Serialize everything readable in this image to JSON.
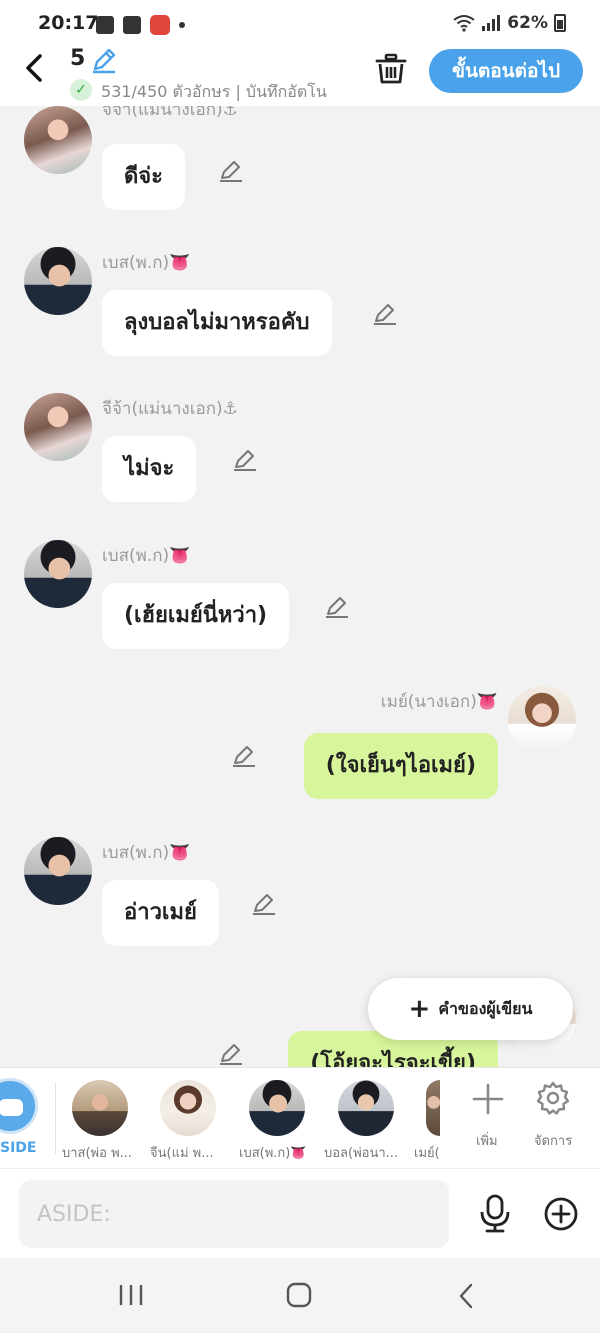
{
  "status_bar": {
    "time": "20:17",
    "battery": "62%"
  },
  "header": {
    "episode_number": "5",
    "counter_text": "531/450 ตัวอักษร | บันทึกอัตโน",
    "next_button": "ขั้นตอนต่อไป"
  },
  "messages": [
    {
      "sender": "จีจ้า(แม่นางเอก)⚓",
      "text": "ดีจ่ะ",
      "side": "left"
    },
    {
      "sender": "เบส(พ.ก)👅",
      "text": "ลุงบอลไม่มาหรอคับ",
      "side": "left"
    },
    {
      "sender": "จีจ้า(แม่นางเอก)⚓",
      "text": "ไม่จะ",
      "side": "left"
    },
    {
      "sender": "เบส(พ.ก)👅",
      "text": "(เฮ้ยเมย์นี่หว่า)",
      "side": "left"
    },
    {
      "sender": "เมย์(นางเอก)👅",
      "text": "(ใจเย็นๆไอเมย์)",
      "side": "right"
    },
    {
      "sender": "เบส(พ.ก)👅",
      "text": "อ่าวเมย์",
      "side": "left"
    },
    {
      "sender": "",
      "text": "(โอ้ยจะไรจะเขี้ย)",
      "side": "right"
    }
  ],
  "author_button": "คำของผู้เขียน",
  "character_bar": {
    "aside_label": "SIDE",
    "characters": [
      "บาส(พ่อ พ...",
      "จีน(แม่ พ...",
      "เบส(พ.ก)👅",
      "บอล(พ่อนา...",
      "เมย์("
    ],
    "add_label": "เพิ่ม",
    "manage_label": "จัดการ"
  },
  "input": {
    "placeholder": "ASIDE:"
  }
}
